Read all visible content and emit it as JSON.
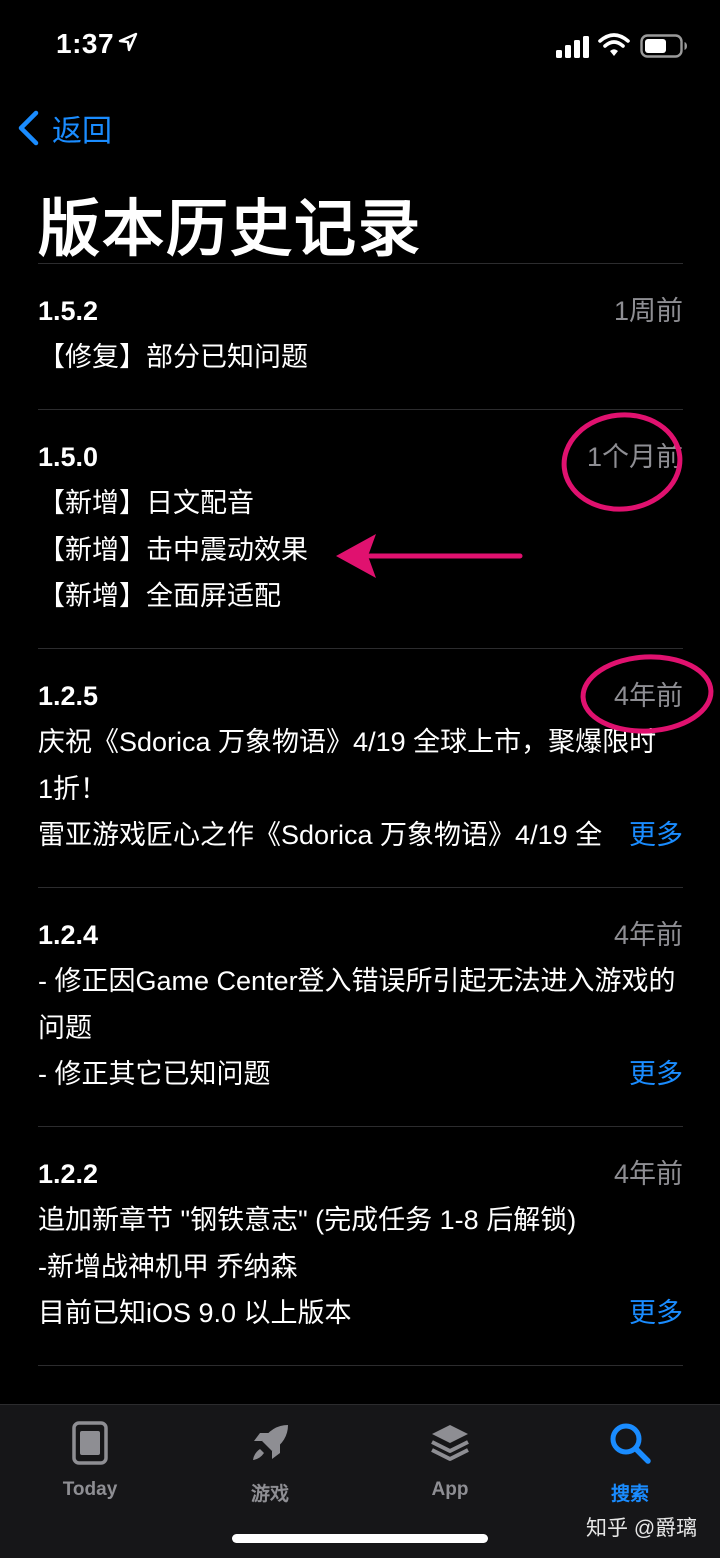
{
  "status_bar": {
    "time": "1:37"
  },
  "nav": {
    "back_label": "返回",
    "title": "版本历史记录"
  },
  "versions": [
    {
      "version": "1.5.2",
      "date": "1周前",
      "notes": [
        "【修复】部分已知问题"
      ]
    },
    {
      "version": "1.5.0",
      "date": "1个月前",
      "notes": [
        "【新增】日文配音",
        "【新增】击中震动效果",
        "【新增】全面屏适配"
      ]
    },
    {
      "version": "1.2.5",
      "date": "4年前",
      "notes": [
        "庆祝《Sdorica 万象物语》4/19 全球上市，聚爆限时1折！",
        "雷亚游戏匠心之作《Sdorica 万象物语》4/19 全"
      ],
      "more": "更多"
    },
    {
      "version": "1.2.4",
      "date": "4年前",
      "notes": [
        "- 修正因Game Center登入错误所引起无法进入游戏的问题",
        "- 修正其它已知问题"
      ],
      "more": "更多"
    },
    {
      "version": "1.2.2",
      "date": "4年前",
      "notes": [
        "追加新章节 \"钢铁意志\" (完成任务 1-8 后解锁)",
        "-新增战神机甲 乔纳森",
        "目前已知iOS 9.0 以上版本"
      ],
      "more": "更多"
    }
  ],
  "tab_bar": {
    "tabs": [
      {
        "label": "Today",
        "icon": "today-icon"
      },
      {
        "label": "游戏",
        "icon": "rocket-icon"
      },
      {
        "label": "App",
        "icon": "layers-icon"
      },
      {
        "label": "搜索",
        "icon": "search-icon",
        "active": true
      }
    ]
  },
  "watermark": "知乎 @爵璃",
  "colors": {
    "accent": "#1a8cff",
    "annotation": "#e0116f",
    "secondary_text": "#8e8e93"
  }
}
